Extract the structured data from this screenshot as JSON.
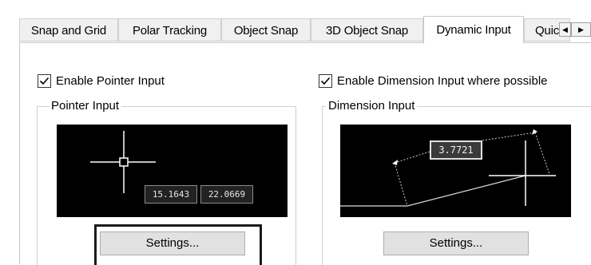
{
  "tabs": [
    {
      "label": "Snap and Grid",
      "active": false
    },
    {
      "label": "Polar Tracking",
      "active": false
    },
    {
      "label": "Object Snap",
      "active": false
    },
    {
      "label": "3D Object Snap",
      "active": false
    },
    {
      "label": "Dynamic Input",
      "active": true
    },
    {
      "label": "Quic",
      "active": false
    }
  ],
  "scroll": {
    "left": "◀",
    "right": "▶"
  },
  "pointer": {
    "checkbox_label": "Enable Pointer Input",
    "checked": true,
    "group_label": "Pointer Input",
    "coord_x": "15.1643",
    "coord_y": "22.0669",
    "settings_label": "Settings..."
  },
  "dimension": {
    "checkbox_label": "Enable Dimension Input where possible",
    "checked": true,
    "group_label": "Dimension Input",
    "value": "3.7721",
    "settings_label": "Settings..."
  },
  "colors": {
    "preview_bg": "#000000",
    "crosshair": "#ffffff",
    "highlight": "#1a1a1a"
  }
}
